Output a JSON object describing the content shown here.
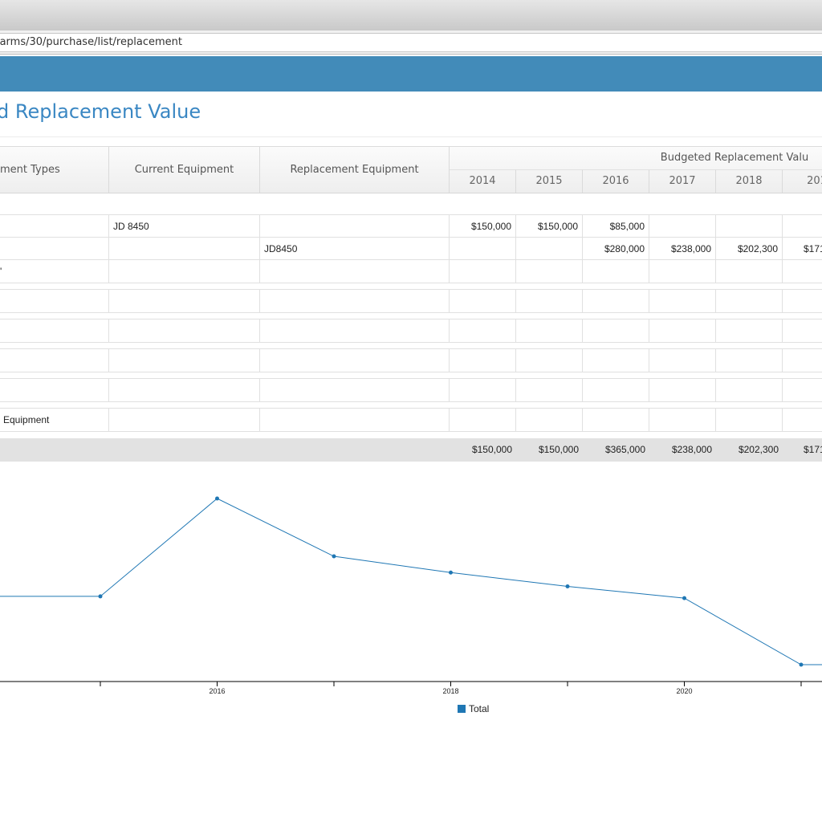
{
  "browser": {
    "url": "farms/30/purchase/list/replacement"
  },
  "page": {
    "title": "d Replacement Value"
  },
  "table": {
    "headers": {
      "types": "ment Types",
      "current": "Current Equipment",
      "replacement": "Replacement Equipment",
      "group": "Budgeted Replacement Valu"
    },
    "years": [
      "2014",
      "2015",
      "2016",
      "2017",
      "2018",
      "201"
    ],
    "rows": [
      {
        "type": "",
        "current": "JD 8450",
        "replacement": "",
        "values": [
          "$150,000",
          "$150,000",
          "$85,000",
          "",
          "",
          ""
        ]
      },
      {
        "type": "",
        "current": "",
        "replacement": "JD8450",
        "values": [
          "",
          "",
          "$280,000",
          "$238,000",
          "$202,300",
          "$171"
        ]
      },
      {
        "type": "'",
        "current": "",
        "replacement": "",
        "values": [
          "",
          "",
          "",
          "",
          "",
          ""
        ]
      },
      {
        "type": "",
        "current": "",
        "replacement": "",
        "values": [
          "",
          "",
          "",
          "",
          "",
          ""
        ]
      },
      {
        "type": "",
        "current": "",
        "replacement": "",
        "values": [
          "",
          "",
          "",
          "",
          "",
          ""
        ]
      },
      {
        "type": "",
        "current": "",
        "replacement": "",
        "values": [
          "",
          "",
          "",
          "",
          "",
          ""
        ]
      },
      {
        "type": "",
        "current": "",
        "replacement": "",
        "values": [
          "",
          "",
          "",
          "",
          "",
          ""
        ]
      },
      {
        "type": "Equipment",
        "current": "",
        "replacement": "",
        "values": [
          "",
          "",
          "",
          "",
          "",
          ""
        ]
      }
    ],
    "totals": [
      "$150,000",
      "$150,000",
      "$365,000",
      "$238,000",
      "$202,300",
      "$171"
    ]
  },
  "chart_data": {
    "type": "line",
    "x": [
      2014,
      2015,
      2016,
      2017,
      2018,
      2019,
      2020,
      2021
    ],
    "series": [
      {
        "name": "Total",
        "values": [
          150000,
          150000,
          365000,
          238000,
          202300,
          171955,
          146162,
          0
        ],
        "color": "#1f77b4"
      }
    ],
    "x_ticks": [
      "2016",
      "2018",
      "2020"
    ],
    "legend": "bottom-center",
    "grid": false
  }
}
